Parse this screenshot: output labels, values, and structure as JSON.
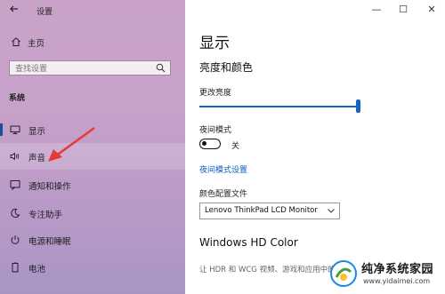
{
  "window": {
    "app_title": "设置",
    "controls": [
      "—",
      "☐",
      "✕"
    ]
  },
  "sidebar": {
    "home_label": "主页",
    "search_placeholder": "查找设置",
    "section_label": "系统",
    "items": [
      {
        "label": "显示",
        "icon": "monitor-icon"
      },
      {
        "label": "声音",
        "icon": "speaker-icon"
      },
      {
        "label": "通知和操作",
        "icon": "notification-icon"
      },
      {
        "label": "专注助手",
        "icon": "moon-icon"
      },
      {
        "label": "电源和睡眠",
        "icon": "power-icon"
      },
      {
        "label": "电池",
        "icon": "battery-icon"
      }
    ]
  },
  "main": {
    "title": "显示",
    "brightness_section": "亮度和颜色",
    "brightness_label": "更改亮度",
    "brightness_value": 0.98,
    "night_mode_label": "夜间模式",
    "night_mode_state": "关",
    "night_mode_link": "夜间模式设置",
    "color_profile_label": "颜色配置文件",
    "color_profile_value": "Lenovo ThinkPad LCD Monitor",
    "hd_color_title": "Windows HD Color",
    "hd_color_desc": "让 HDR 和 WCG 视频、游戏和应用中的画面"
  },
  "watermark": {
    "title": "纯净系统家园",
    "url": "www.yidaimei.com"
  },
  "colors": {
    "accent": "#1565c0",
    "link": "#0a5fc2",
    "sidebar_bg": "#c9a3c7",
    "arrow": "#e53935"
  }
}
